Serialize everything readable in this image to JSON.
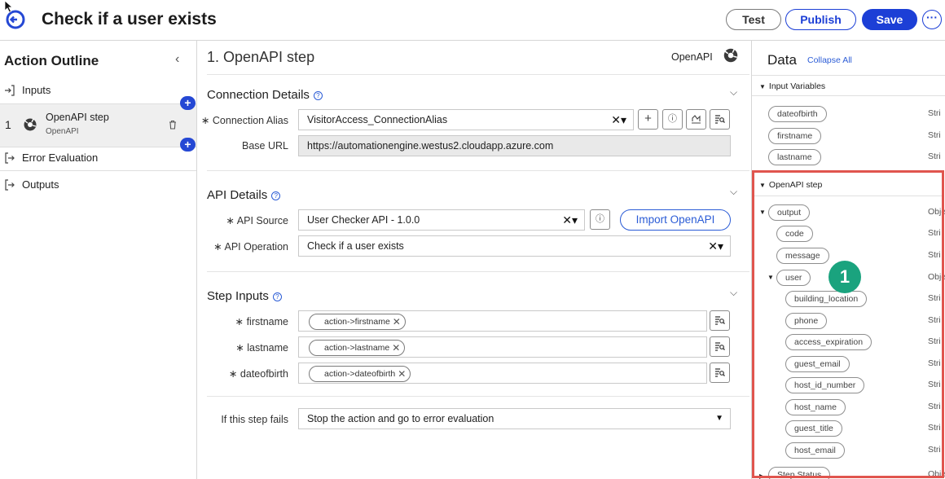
{
  "header": {
    "title": "Check if a user exists",
    "test_label": "Test",
    "publish_label": "Publish",
    "save_label": "Save",
    "more_label": "···"
  },
  "outline": {
    "title": "Action Outline",
    "collapse_glyph": "‹",
    "items": {
      "inputs": "Inputs",
      "step_number": "1",
      "step_name": "OpenAPI step",
      "step_sub": "OpenAPI",
      "error_evaluation": "Error Evaluation",
      "outputs": "Outputs"
    },
    "add_glyph": "+"
  },
  "step": {
    "heading": "1.  OpenAPI step",
    "type_label": "OpenAPI",
    "connection": {
      "title": "Connection Details",
      "alias_label": "∗ Connection Alias",
      "alias_value": "VisitorAccess_ConnectionAlias",
      "base_url_label": "Base URL",
      "base_url_value": "https://automationengine.westus2.cloudapp.azure.com"
    },
    "api": {
      "title": "API Details",
      "source_label": "∗ API Source",
      "source_value": "User Checker API - 1.0.0",
      "import_label": "Import OpenAPI",
      "operation_label": "∗ API Operation",
      "operation_value": "Check if a user exists"
    },
    "inputs": {
      "title": "Step Inputs",
      "rows": [
        {
          "label": "∗ firstname",
          "chip": "action->firstname"
        },
        {
          "label": "∗ lastname",
          "chip": "action->lastname"
        },
        {
          "label": "∗ dateofbirth",
          "chip": "action->dateofbirth"
        }
      ]
    },
    "fail": {
      "label": "If this step fails",
      "value": "Stop the action and go to error evaluation"
    },
    "clear_glyph": "✕▾"
  },
  "data": {
    "title": "Data",
    "collapse_all": "Collapse All",
    "input_variables": {
      "title": "Input Variables",
      "items": [
        {
          "name": "dateofbirth",
          "type": "Stri"
        },
        {
          "name": "firstname",
          "type": "Stri"
        },
        {
          "name": "lastname",
          "type": "Stri"
        }
      ]
    },
    "openapi_step": {
      "title": "OpenAPI step",
      "output": {
        "name": "output",
        "type": "Obje"
      },
      "code": {
        "name": "code",
        "type": "Stri"
      },
      "message": {
        "name": "message",
        "type": "Stri"
      },
      "user": {
        "name": "user",
        "type": "Obje"
      },
      "user_fields": [
        {
          "name": "building_location",
          "type": "Stri"
        },
        {
          "name": "phone",
          "type": "Stri"
        },
        {
          "name": "access_expiration",
          "type": "Stri"
        },
        {
          "name": "guest_email",
          "type": "Stri"
        },
        {
          "name": "host_id_number",
          "type": "Stri"
        },
        {
          "name": "host_name",
          "type": "Stri"
        },
        {
          "name": "guest_title",
          "type": "Stri"
        },
        {
          "name": "host_email",
          "type": "Stri"
        }
      ],
      "step_status": {
        "name": "Step Status",
        "type": "Obje"
      }
    },
    "badge": "1"
  },
  "colors": {
    "accent": "#1c3fd6",
    "highlight": "#e0554e",
    "badge": "#1aa37e"
  }
}
